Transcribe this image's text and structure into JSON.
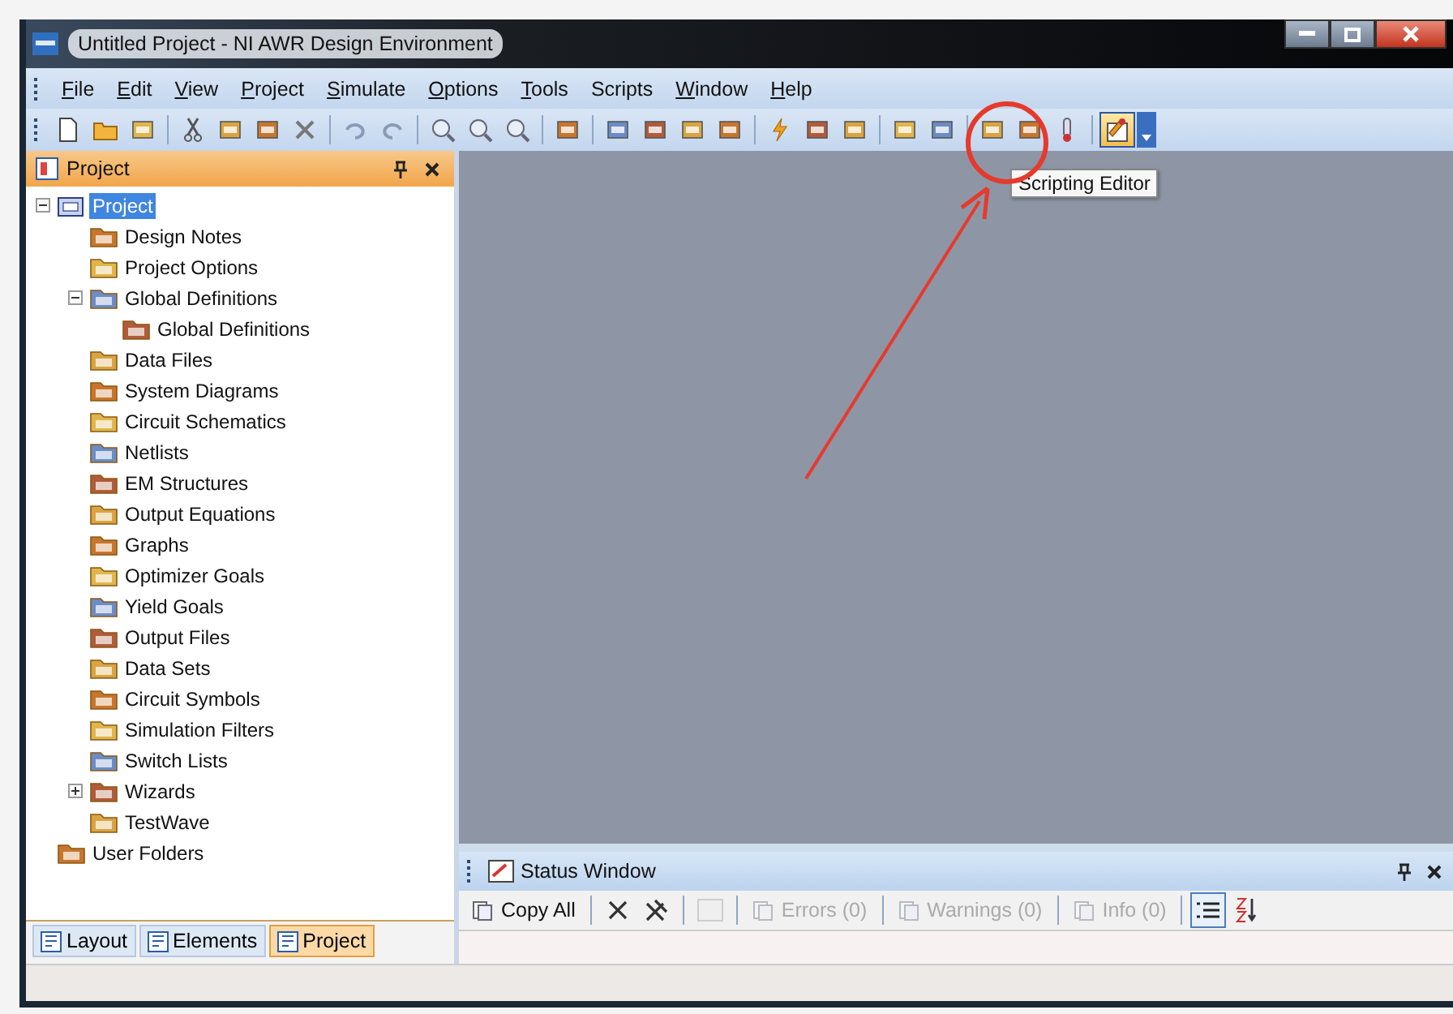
{
  "window": {
    "title": "Untitled Project - NI AWR Design Environment"
  },
  "menu": [
    {
      "access_key": "F",
      "rest": "ile"
    },
    {
      "access_key": "E",
      "rest": "dit"
    },
    {
      "access_key": "V",
      "rest": "iew"
    },
    {
      "access_key": "P",
      "rest": "roject"
    },
    {
      "access_key": "S",
      "rest": "imulate"
    },
    {
      "access_key": "O",
      "rest": "ptions"
    },
    {
      "access_key": "T",
      "rest": "ools"
    },
    {
      "rest": "Scripts"
    },
    {
      "access_key": "W",
      "rest": "indow"
    },
    {
      "access_key": "H",
      "rest": "elp"
    }
  ],
  "tooltip": "Scripting Editor",
  "project_panel": {
    "title": "Project",
    "tree": [
      {
        "label": "Project",
        "selected": true,
        "expanded": true,
        "children": [
          {
            "label": "Design Notes",
            "selected": false
          },
          {
            "label": "Project Options",
            "selected": false
          },
          {
            "label": "Global Definitions",
            "selected": false,
            "expanded": true,
            "children": [
              {
                "label": "Global Definitions",
                "selected": false
              }
            ]
          },
          {
            "label": "Data Files",
            "selected": false
          },
          {
            "label": "System Diagrams",
            "selected": false
          },
          {
            "label": "Circuit Schematics",
            "selected": false
          },
          {
            "label": "Netlists",
            "selected": false
          },
          {
            "label": "EM Structures",
            "selected": false
          },
          {
            "label": "Output Equations",
            "selected": false
          },
          {
            "label": "Graphs",
            "selected": false
          },
          {
            "label": "Optimizer Goals",
            "selected": false
          },
          {
            "label": "Yield Goals",
            "selected": false
          },
          {
            "label": "Output Files",
            "selected": false
          },
          {
            "label": "Data Sets",
            "selected": false
          },
          {
            "label": "Circuit Symbols",
            "selected": false
          },
          {
            "label": "Simulation Filters",
            "selected": false
          },
          {
            "label": "Switch Lists",
            "selected": false
          },
          {
            "label": "Wizards",
            "selected": false,
            "expanded": false
          },
          {
            "label": "TestWave",
            "selected": false
          }
        ]
      },
      {
        "label": "User Folders",
        "selected": false
      }
    ]
  },
  "panel_tabs": [
    {
      "label": "Layout",
      "selected": false
    },
    {
      "label": "Elements",
      "selected": false
    },
    {
      "label": "Project",
      "selected": true
    }
  ],
  "status_window": {
    "title": "Status Window",
    "toolbar": [
      {
        "label": "Copy All",
        "disabled": false
      },
      {
        "label": "Errors (0)",
        "disabled": true
      },
      {
        "label": "Warnings (0)",
        "disabled": true
      },
      {
        "label": "Info (0)",
        "disabled": true
      }
    ]
  }
}
